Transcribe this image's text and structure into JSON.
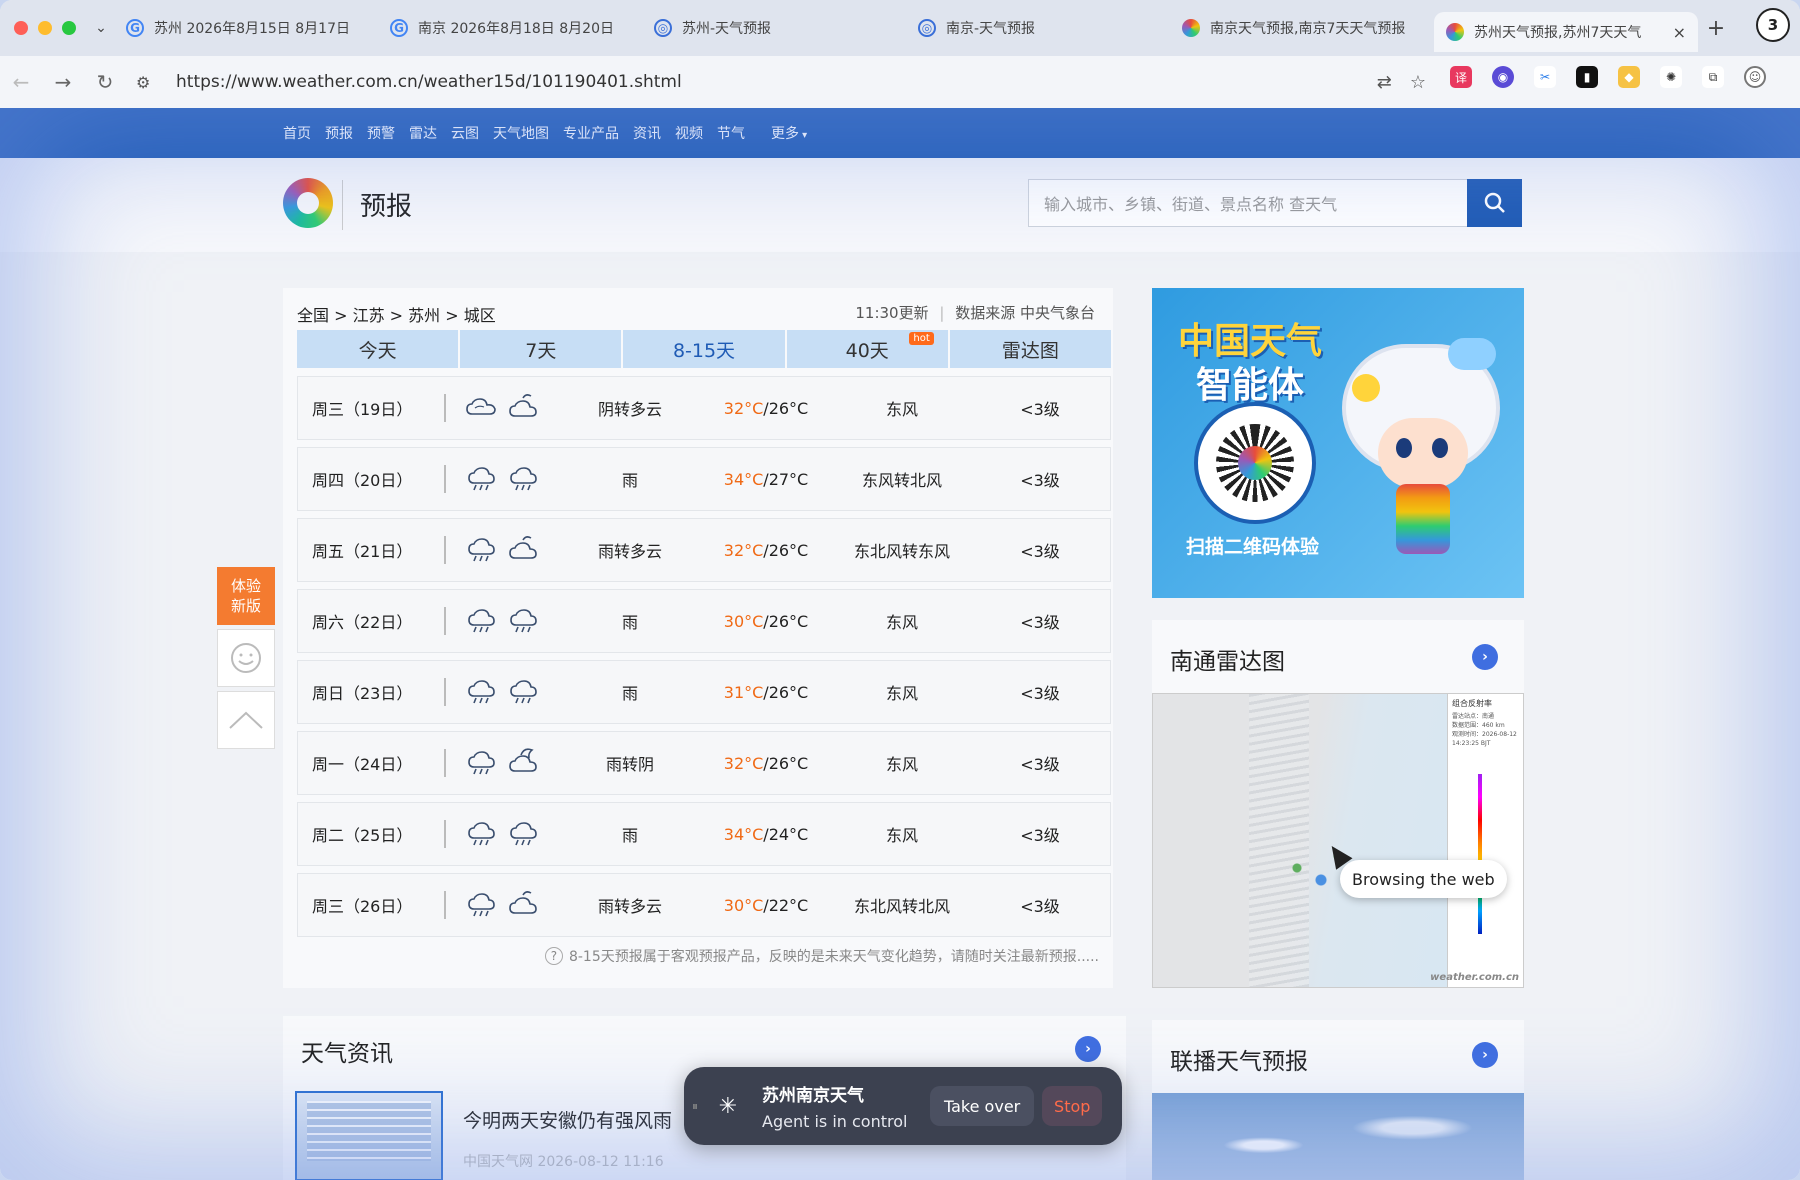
{
  "browser": {
    "tabs": [
      {
        "title": "苏州 2026年8月15日 8月17日",
        "favicon": "google-icon"
      },
      {
        "title": "南京 2026年8月18日 8月20日",
        "favicon": "google-icon"
      },
      {
        "title": "苏州-天气预报",
        "favicon": "weather-icon"
      },
      {
        "title": "南京-天气预报",
        "favicon": "weather-icon"
      },
      {
        "title": "南京天气预报,南京7天天气预报",
        "favicon": "weather-swirl-icon"
      },
      {
        "title": "苏州天气预报,苏州7天天气",
        "favicon": "weather-swirl-icon"
      }
    ],
    "profile_count": "3",
    "url": "https://www.weather.com.cn/weather15d/101190401.shtml"
  },
  "site": {
    "nav": [
      "首页",
      "预报",
      "预警",
      "雷达",
      "云图",
      "天气地图",
      "专业产品",
      "资讯",
      "视频",
      "节气",
      "更多"
    ],
    "logo_text": "预报",
    "search_placeholder": "输入城市、乡镇、街道、景点名称 查天气"
  },
  "forecast": {
    "breadcrumb": "全国 > 江苏 > 苏州 > 城区",
    "update_time": "11:30更新",
    "source": "数据来源 中央气象台",
    "tabs": [
      {
        "label": "今天",
        "active": false,
        "hot": false
      },
      {
        "label": "7天",
        "active": false,
        "hot": false
      },
      {
        "label": "8-15天",
        "active": true,
        "hot": false
      },
      {
        "label": "40天",
        "active": false,
        "hot": true
      },
      {
        "label": "雷达图",
        "active": false,
        "hot": false
      }
    ],
    "hot_badge": "hot",
    "days": [
      {
        "date": "周三（19日）",
        "icons": [
          "cloudy-icon",
          "partly-cloudy-icon"
        ],
        "weather": "阴转多云",
        "high": "32°C",
        "low": "/26°C",
        "wind": "东风",
        "level": "<3级"
      },
      {
        "date": "周四（20日）",
        "icons": [
          "rain-icon",
          "rain-icon"
        ],
        "weather": "雨",
        "high": "34°C",
        "low": "/27°C",
        "wind": "东风转北风",
        "level": "<3级"
      },
      {
        "date": "周五（21日）",
        "icons": [
          "rain-icon",
          "partly-cloudy-icon"
        ],
        "weather": "雨转多云",
        "high": "32°C",
        "low": "/26°C",
        "wind": "东北风转东风",
        "level": "<3级"
      },
      {
        "date": "周六（22日）",
        "icons": [
          "rain-icon",
          "rain-icon"
        ],
        "weather": "雨",
        "high": "30°C",
        "low": "/26°C",
        "wind": "东风",
        "level": "<3级"
      },
      {
        "date": "周日（23日）",
        "icons": [
          "rain-icon",
          "rain-icon"
        ],
        "weather": "雨",
        "high": "31°C",
        "low": "/26°C",
        "wind": "东风",
        "level": "<3级"
      },
      {
        "date": "周一（24日）",
        "icons": [
          "rain-icon",
          "overcast-icon"
        ],
        "weather": "雨转阴",
        "high": "32°C",
        "low": "/26°C",
        "wind": "东风",
        "level": "<3级"
      },
      {
        "date": "周二（25日）",
        "icons": [
          "rain-icon",
          "rain-icon"
        ],
        "weather": "雨",
        "high": "34°C",
        "low": "/24°C",
        "wind": "东风",
        "level": "<3级"
      },
      {
        "date": "周三（26日）",
        "icons": [
          "rain-icon",
          "partly-cloudy-icon"
        ],
        "weather": "雨转多云",
        "high": "30°C",
        "low": "/22°C",
        "wind": "东北风转北风",
        "level": "<3级"
      }
    ],
    "note": "8-15天预报属于客观预报产品，反映的是未来天气变化趋势，请随时关注最新预报....."
  },
  "side": {
    "try_new": "体验新版"
  },
  "ad": {
    "title_line1": "中国天气",
    "title_line2": "智能体",
    "scan_text": "扫描二维码体验"
  },
  "radar": {
    "title": "南通雷达图",
    "legend_title": "组合反射率",
    "legend_info": "雷达站点：南通\n数据范围：460 km\n观测时间：2026-08-12\n14:23:25 BJT",
    "watermark": "weather.com.cn"
  },
  "news": {
    "title": "天气资讯",
    "headline": "今明两天安徽仍有强风雨",
    "meta": "中国天气网 2026-08-12 11:16"
  },
  "broadcast": {
    "title": "联播天气预报"
  },
  "agent": {
    "title": "苏州南京天气",
    "status": "Agent is in control",
    "take_over": "Take over",
    "stop": "Stop",
    "tooltip": "Browsing the web"
  },
  "colors": {
    "nav_blue": "#1f5bb5",
    "high_temp": "#f06a16",
    "tab_bg": "#c7def5",
    "try_new": "#f47b30"
  }
}
